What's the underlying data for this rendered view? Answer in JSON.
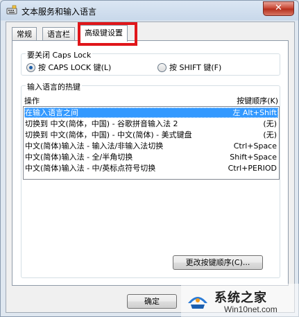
{
  "window": {
    "title": "文本服务和输入语言",
    "close_glyph": "✕"
  },
  "tabs": [
    {
      "label": "常规"
    },
    {
      "label": "语言栏"
    },
    {
      "label": "高级键设置"
    }
  ],
  "caps_lock": {
    "group_label": "要关闭 Caps Lock",
    "option_caps": "按 CAPS LOCK 键(L)",
    "option_shift": "按 SHIFT 键(F)",
    "selected": "caps"
  },
  "hotkeys": {
    "group_label": "输入语言的热键",
    "col_action": "操作",
    "col_sequence": "按键顺序(K)",
    "rows": [
      {
        "action": "在输入语言之间",
        "keys": "左 Alt+Shift"
      },
      {
        "action": "切换到 中文(简体，中国) - 谷歌拼音输入法 2",
        "keys": "(无)"
      },
      {
        "action": "切换到 中文(简体，中国) - 中文(简体) - 美式键盘",
        "keys": "(无)"
      },
      {
        "action": "中文(简体)输入法 - 输入法/非输入法切换",
        "keys": "Ctrl+Space"
      },
      {
        "action": "中文(简体)输入法 - 全/半角切换",
        "keys": "Shift+Space"
      },
      {
        "action": "中文(简体)输入法 - 中/英标点符号切换",
        "keys": "Ctrl+PERIOD"
      }
    ],
    "change_button": "更改按键顺序(C)..."
  },
  "footer": {
    "ok_button": "确定"
  },
  "watermark": {
    "main": "系统之家",
    "sub": "Win10net.com"
  },
  "colors": {
    "selection": "#3399ff",
    "highlight_box": "#e0161a"
  }
}
